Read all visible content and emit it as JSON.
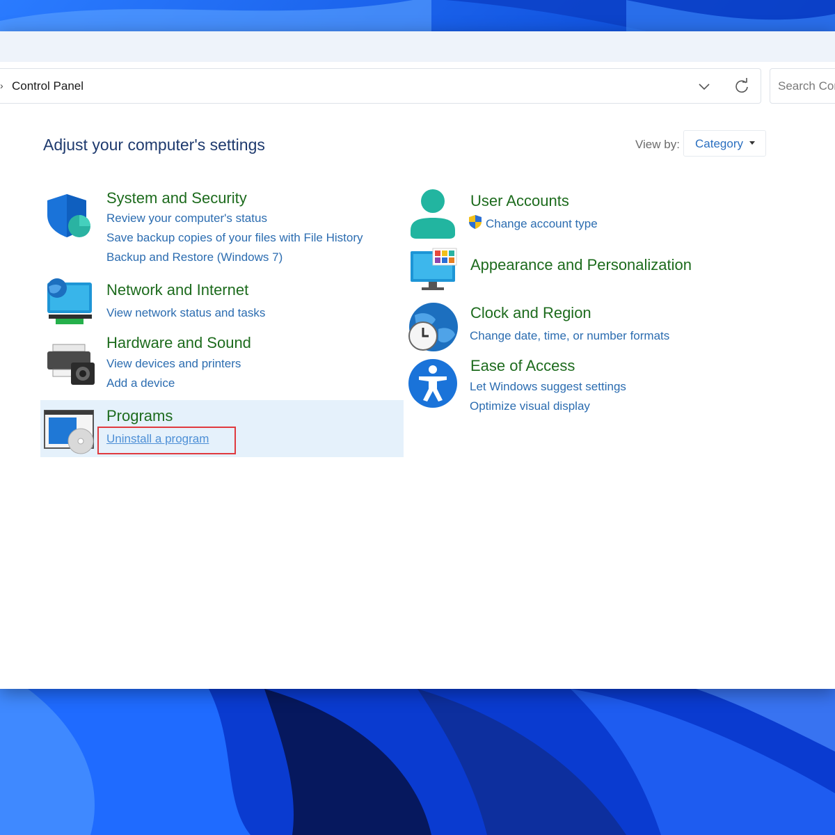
{
  "window": {
    "breadcrumb": "Control Panel",
    "search_placeholder": "Search Control Panel"
  },
  "main": {
    "heading": "Adjust your computer's settings",
    "view_by_label": "View by:",
    "view_by_value": "Category"
  },
  "categories": {
    "system_security": {
      "title": "System and Security",
      "links": [
        "Review your computer's status",
        "Save backup copies of your files with File History",
        "Backup and Restore (Windows 7)"
      ]
    },
    "network": {
      "title": "Network and Internet",
      "links": [
        "View network status and tasks"
      ]
    },
    "hardware": {
      "title": "Hardware and Sound",
      "links": [
        "View devices and printers",
        "Add a device"
      ]
    },
    "programs": {
      "title": "Programs",
      "links": [
        "Uninstall a program"
      ]
    },
    "user_accounts": {
      "title": "User Accounts",
      "links": [
        "Change account type"
      ]
    },
    "appearance": {
      "title": "Appearance and Personalization",
      "links": []
    },
    "clock": {
      "title": "Clock and Region",
      "links": [
        "Change date, time, or number formats"
      ]
    },
    "ease": {
      "title": "Ease of Access",
      "links": [
        "Let Windows suggest settings",
        "Optimize visual display"
      ]
    }
  },
  "colors": {
    "category_title": "#1d6b1d",
    "link": "#2b6cb0",
    "highlight": "#e5f1fb",
    "annotation_box": "#e0393e"
  },
  "icons": {
    "system_security": "shield-icon",
    "network": "globe-monitor-icon",
    "hardware": "printer-speaker-icon",
    "programs": "program-disc-icon",
    "user_accounts": "user-icon",
    "appearance": "monitor-tiles-icon",
    "clock": "globe-clock-icon",
    "ease": "accessibility-icon",
    "uac": "uac-shield-icon"
  }
}
